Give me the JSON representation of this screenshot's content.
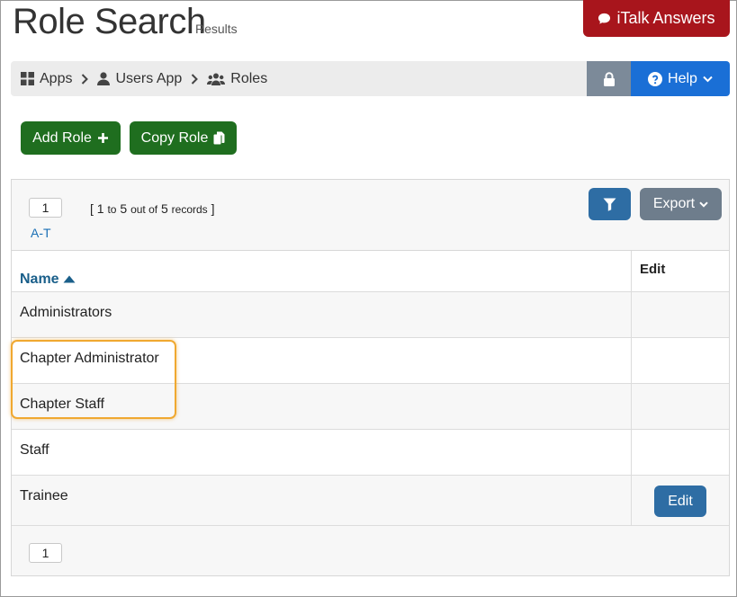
{
  "header": {
    "title": "Role Search",
    "subtitle": "Results",
    "italk_label": "iTalk Answers"
  },
  "breadcrumb": {
    "items": [
      {
        "label": "Apps",
        "icon": "grid-icon"
      },
      {
        "label": "Users App",
        "icon": "user-icon"
      },
      {
        "label": "Roles",
        "icon": "users-icon"
      }
    ]
  },
  "topnav": {
    "help_label": "Help"
  },
  "actions": {
    "add_role_label": "Add Role",
    "copy_role_label": "Copy Role"
  },
  "pagination": {
    "current_page": "1",
    "range_open": "[ 1",
    "to_word": "to",
    "range_end": "5",
    "out_of_word": "out of",
    "total": "5",
    "records_word": "records",
    "range_close": "]",
    "alpha_range": "A-T"
  },
  "toolbar": {
    "export_label": "Export"
  },
  "table": {
    "columns": {
      "name": "Name",
      "edit": "Edit"
    },
    "rows": [
      {
        "name": "Administrators"
      },
      {
        "name": "Chapter Administrator"
      },
      {
        "name": "Chapter Staff"
      },
      {
        "name": "Staff"
      },
      {
        "name": "Trainee",
        "edit_label": "Edit"
      }
    ]
  },
  "colors": {
    "italk": "#a8151c",
    "help": "#1a6fd6",
    "lock": "#7c8a99",
    "green": "#1f6e1f",
    "primary": "#2e6da4",
    "export": "#6e7d8c",
    "highlight": "#f0a830"
  }
}
